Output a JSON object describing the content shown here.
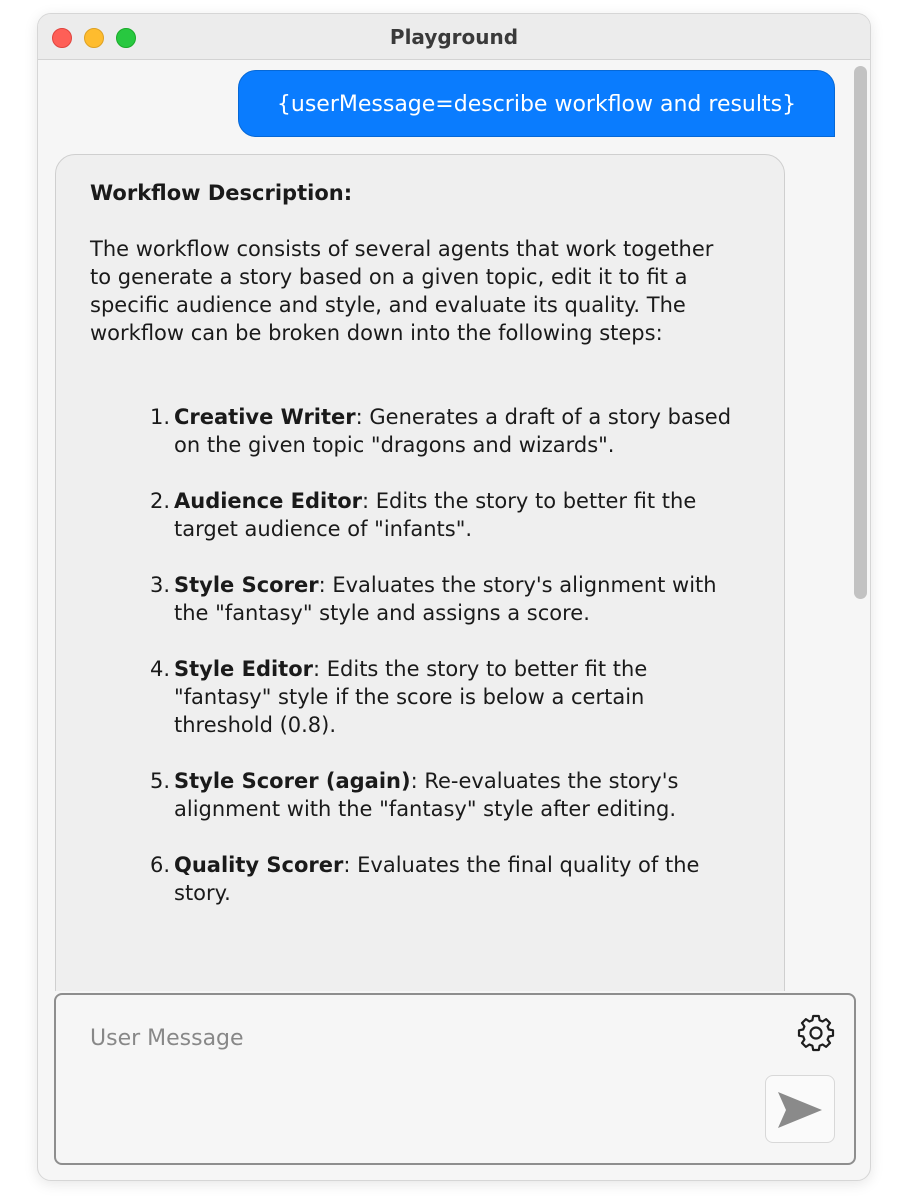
{
  "window": {
    "title": "Playground"
  },
  "chat": {
    "user_message": "{userMessage=describe workflow and results}",
    "assistant": {
      "heading": "Workflow Description:",
      "intro": "The workflow consists of several agents that work together to generate a story based on a given topic, edit it to fit a specific audience and style, and evaluate its quality. The workflow can be broken down into the following steps:",
      "steps": [
        {
          "num": "1.",
          "name": "Creative Writer",
          "desc": ": Generates a draft of a story based on the given topic \"dragons and wizards\"."
        },
        {
          "num": "2.",
          "name": "Audience Editor",
          "desc": ": Edits the story to better fit the target audience of \"infants\"."
        },
        {
          "num": "3.",
          "name": "Style Scorer",
          "desc": ": Evaluates the story's alignment with the \"fantasy\" style and assigns a score."
        },
        {
          "num": "4.",
          "name": "Style Editor",
          "desc": ": Edits the story to better fit the \"fantasy\" style if the score is below a certain threshold (0.8)."
        },
        {
          "num": "5.",
          "name": "Style Scorer (again)",
          "desc": ": Re-evaluates the story's alignment with the \"fantasy\" style after editing."
        },
        {
          "num": "6.",
          "name": "Quality Scorer",
          "desc": ": Evaluates the final quality of the story."
        }
      ]
    }
  },
  "composer": {
    "placeholder": "User Message",
    "value": "",
    "settings_icon": "gear-icon",
    "send_icon": "send-icon"
  },
  "colors": {
    "user_bubble": "#0a7cfe",
    "assistant_bubble": "#efefef",
    "window_bg": "#f6f6f6",
    "traffic_close": "#fe5f57",
    "traffic_minimize": "#febc2e",
    "traffic_zoom": "#28c840"
  }
}
